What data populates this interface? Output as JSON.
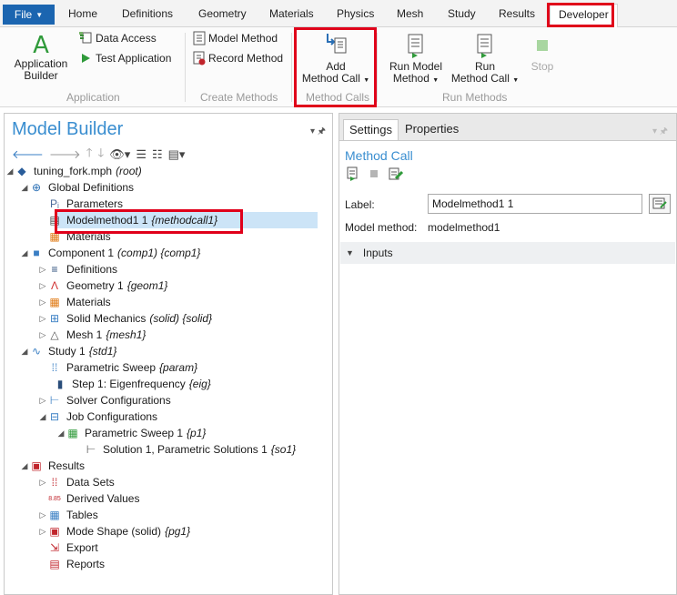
{
  "menu": {
    "file_label": "File",
    "tabs": [
      "Home",
      "Definitions",
      "Geometry",
      "Materials",
      "Physics",
      "Mesh",
      "Study",
      "Results",
      "Developer"
    ]
  },
  "ribbon": {
    "application": {
      "builder_label_1": "Application",
      "builder_label_2": "Builder",
      "data_access": "Data Access",
      "test_application": "Test Application",
      "group": "Application"
    },
    "create_methods": {
      "model_method": "Model Method",
      "record_method": "Record Method",
      "group": "Create Methods"
    },
    "method_call": {
      "add_1": "Add",
      "add_2": "Method Call",
      "group": "Method Calls"
    },
    "run_methods": {
      "run_model_1": "Run Model",
      "run_model_2": "Method",
      "run_call_1": "Run",
      "run_call_2": "Method Call",
      "stop": "Stop",
      "group": "Run Methods"
    }
  },
  "model_builder": {
    "title": "Model Builder",
    "tree": [
      {
        "label": "tuning_fork.mph",
        "tag": "(root)"
      },
      {
        "label": "Global Definitions",
        "tag": ""
      },
      {
        "label": "Parameters",
        "tag": ""
      },
      {
        "label": "Modelmethod1 1",
        "tag": "{methodcall1}"
      },
      {
        "label": "Materials",
        "tag": ""
      },
      {
        "label": "Component 1",
        "tag": "(comp1) {comp1}"
      },
      {
        "label": "Definitions",
        "tag": ""
      },
      {
        "label": "Geometry 1",
        "tag": "{geom1}"
      },
      {
        "label": "Materials",
        "tag": ""
      },
      {
        "label": "Solid Mechanics",
        "tag": "(solid) {solid}"
      },
      {
        "label": "Mesh 1",
        "tag": "{mesh1}"
      },
      {
        "label": "Study 1",
        "tag": "{std1}"
      },
      {
        "label": "Parametric Sweep",
        "tag": "{param}"
      },
      {
        "label": "Step 1: Eigenfrequency",
        "tag": "{eig}"
      },
      {
        "label": "Solver Configurations",
        "tag": ""
      },
      {
        "label": "Job Configurations",
        "tag": ""
      },
      {
        "label": "Parametric Sweep 1",
        "tag": "{p1}"
      },
      {
        "label": "Solution 1, Parametric Solutions 1",
        "tag": "{so1}"
      },
      {
        "label": "Results",
        "tag": ""
      },
      {
        "label": "Data Sets",
        "tag": ""
      },
      {
        "label": "Derived Values",
        "tag": ""
      },
      {
        "label": "Tables",
        "tag": ""
      },
      {
        "label": "Mode Shape (solid)",
        "tag": "{pg1}"
      },
      {
        "label": "Export",
        "tag": ""
      },
      {
        "label": "Reports",
        "tag": ""
      }
    ]
  },
  "settings": {
    "tab_settings": "Settings",
    "tab_properties": "Properties",
    "title": "Method Call",
    "label_label": "Label:",
    "label_value": "Modelmethod1 1",
    "model_method_label": "Model method:",
    "model_method_value": "modelmethod1",
    "section_inputs": "Inputs"
  },
  "colors": {
    "accent": "#1b65b0",
    "highlight": "#e0001a",
    "selection": "#cce4f7",
    "title_blue": "#3a8ed0"
  }
}
